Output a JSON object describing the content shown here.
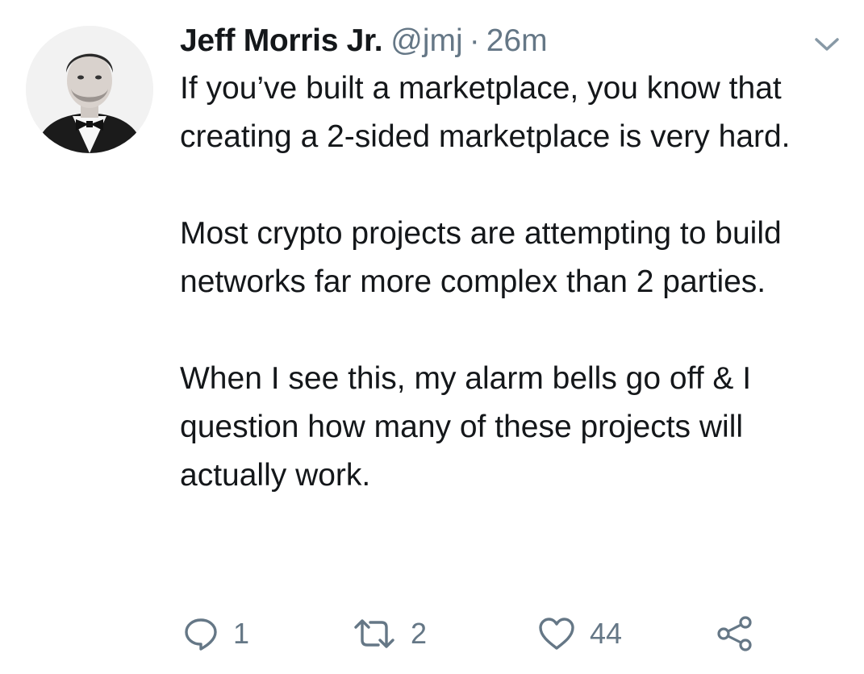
{
  "tweet": {
    "author_name": "Jeff Morris Jr.",
    "handle": "@jmj",
    "separator": "·",
    "time": "26m",
    "paragraphs": [
      "If you’ve built a marketplace, you know that creating a 2-sided marketplace is very hard.",
      "Most crypto projects are attempting to build networks far more complex than 2 parties.",
      "When I see this, my alarm bells go off & I question how many of these projects will actually work."
    ],
    "counts": {
      "replies": "1",
      "retweets": "2",
      "likes": "44"
    }
  },
  "colors": {
    "text": "#14171a",
    "secondary": "#657786",
    "background": "#ffffff"
  },
  "icons": {
    "menu": "chevron-down-icon",
    "reply": "reply-icon",
    "retweet": "retweet-icon",
    "like": "heart-icon",
    "share": "share-icon"
  }
}
